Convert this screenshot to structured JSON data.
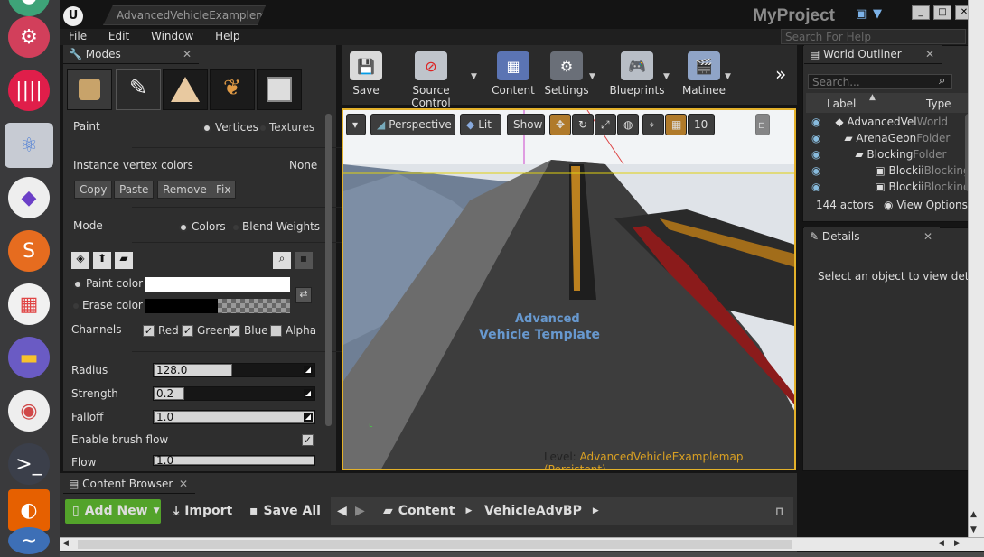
{
  "window": {
    "tab_title": "AdvancedVehicleExamplema",
    "project_name": "MyProject"
  },
  "menu": [
    "File",
    "Edit",
    "Window",
    "Help"
  ],
  "help_search": {
    "placeholder": "Search For Help"
  },
  "modes": {
    "title": "Modes",
    "paint": {
      "label": "Paint",
      "options": [
        "Vertices",
        "Textures"
      ],
      "selected": "Vertices"
    },
    "instance_vertex_colors": {
      "label": "Instance vertex colors",
      "value": "None"
    },
    "buttons": [
      "Copy",
      "Paste",
      "Remove",
      "Fix"
    ],
    "mode": {
      "label": "Mode",
      "options": [
        "Colors",
        "Blend Weights"
      ],
      "selected": "Colors"
    },
    "paint_color_label": "Paint color",
    "erase_color_label": "Erase color",
    "paint_color": "#ffffff",
    "erase_color": "#000000",
    "channels": {
      "label": "Channels",
      "items": [
        {
          "name": "Red",
          "checked": true
        },
        {
          "name": "Green",
          "checked": true
        },
        {
          "name": "Blue",
          "checked": true
        },
        {
          "name": "Alpha",
          "checked": false
        }
      ]
    },
    "radius": {
      "label": "Radius",
      "value": "128.0",
      "fraction": 0.49
    },
    "strength": {
      "label": "Strength",
      "value": "0.2",
      "fraction": 0.19
    },
    "falloff": {
      "label": "Falloff",
      "value": "1.0",
      "fraction": 1.0
    },
    "enable_brush_flow": {
      "label": "Enable brush flow",
      "checked": true
    },
    "flow": {
      "label": "Flow",
      "value": "1.0",
      "fraction": 1.0
    }
  },
  "toolbar": [
    {
      "label": "Save",
      "icon": "save-icon",
      "dropdown": false
    },
    {
      "label": "Source Control",
      "icon": "source-control-icon",
      "dropdown": true
    },
    {
      "label": "Content",
      "icon": "content-icon",
      "dropdown": false
    },
    {
      "label": "Settings",
      "icon": "settings-icon",
      "dropdown": true
    },
    {
      "label": "Blueprints",
      "icon": "blueprints-icon",
      "dropdown": true
    },
    {
      "label": "Matinee",
      "icon": "matinee-icon",
      "dropdown": true
    }
  ],
  "viewport": {
    "perspective": "Perspective",
    "lit": "Lit",
    "show": "Show",
    "grid_snap": "10",
    "level_label": "Level:",
    "level_name": "AdvancedVehicleExamplemap (Persistent)",
    "scene_text_1": "Advanced",
    "scene_text_2": "Vehicle Template"
  },
  "outliner": {
    "title": "World Outliner",
    "search_placeholder": "Search...",
    "col_label": "Label",
    "col_type": "Type",
    "rows": [
      {
        "label": "AdvancedVel",
        "type": "World"
      },
      {
        "label": "ArenaGeon",
        "type": "Folder"
      },
      {
        "label": "Blocking",
        "type": "Folder"
      },
      {
        "label": "Blockii",
        "type": "Blocking"
      },
      {
        "label": "Blockii",
        "type": "Blocking"
      }
    ],
    "actor_count": "144 actors",
    "view_options": "View Options"
  },
  "details": {
    "title": "Details",
    "empty_text": "Select an object to view details"
  },
  "content_browser": {
    "title": "Content Browser",
    "add_new": "Add New",
    "import": "Import",
    "save_all": "Save All",
    "path": [
      "Content",
      "VehicleAdvBP"
    ]
  },
  "colors": {
    "viewport_border": "#e3b12a",
    "add_new_bg": "#53a32a"
  }
}
